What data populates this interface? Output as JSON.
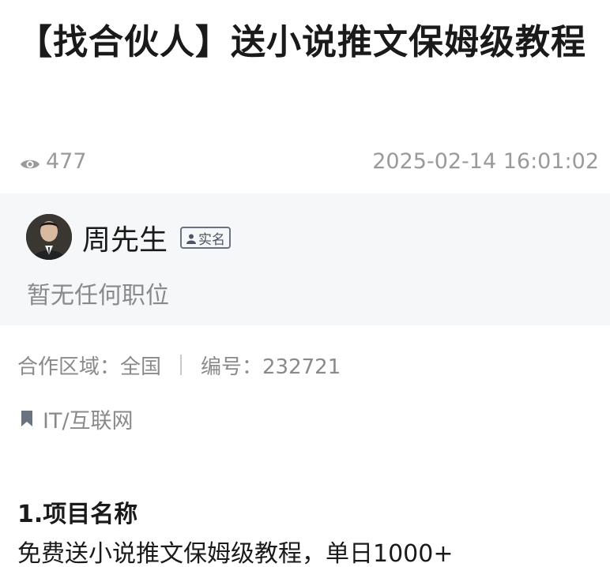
{
  "post": {
    "title": "【找合伙人】送小说推文保姆级教程",
    "views": "477",
    "datetime": "2025-02-14 16:01:02"
  },
  "author": {
    "name": "周先生",
    "badge": "实名",
    "position": "暂无任何职位"
  },
  "info": {
    "region": "合作区域：全国",
    "number": "编号：232721",
    "industry": "IT/互联网"
  },
  "content": {
    "section_title": "1.项目名称",
    "section_text": "免费送小说推文保姆级教程，单日1000+"
  },
  "icons": {
    "views": "eye-icon",
    "badge": "person-icon",
    "industry": "bookmark-icon"
  },
  "colors": {
    "text": "#1a1a1a",
    "muted": "#8a8a8a",
    "card_bg": "#f6f7f9"
  }
}
